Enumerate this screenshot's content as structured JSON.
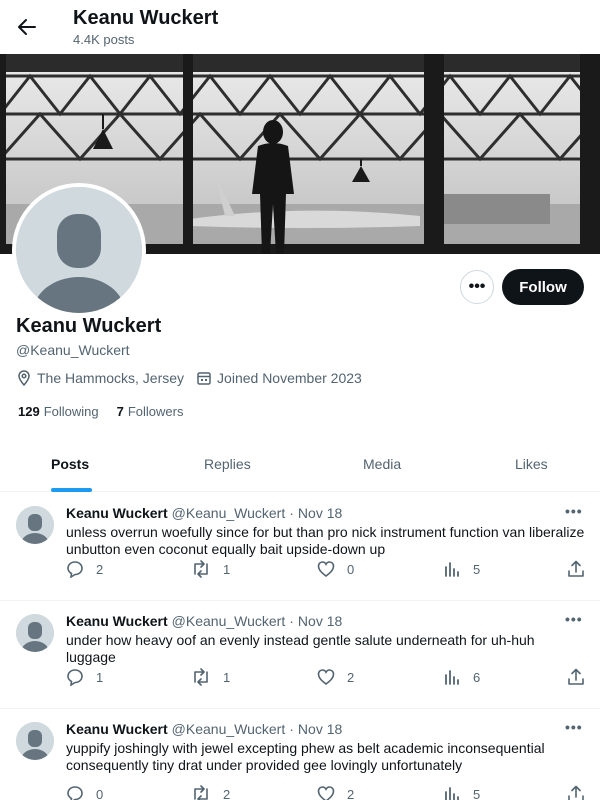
{
  "header": {
    "name": "Keanu Wuckert",
    "post_count": "4.4K posts"
  },
  "profile": {
    "name": "Keanu Wuckert",
    "handle": "@Keanu_Wuckert",
    "location": "The Hammocks, Jersey",
    "joined": "Joined November 2023",
    "following_count": "129",
    "following_label": "Following",
    "followers_count": "7",
    "followers_label": "Followers",
    "follow_label": "Follow",
    "more_label": "•••"
  },
  "tabs": [
    {
      "label": "Posts",
      "active": true
    },
    {
      "label": "Replies",
      "active": false
    },
    {
      "label": "Media",
      "active": false
    },
    {
      "label": "Likes",
      "active": false
    }
  ],
  "posts": [
    {
      "name": "Keanu Wuckert",
      "handle": "@Keanu_Wuckert",
      "dot": "·",
      "date": "Nov 18",
      "text": "unless overrun woefully since for but than pro nick instrument function van liberalize unbutton even coconut equally bait upside-down up",
      "replies": "2",
      "reposts": "1",
      "likes": "0",
      "views": "5"
    },
    {
      "name": "Keanu Wuckert",
      "handle": "@Keanu_Wuckert",
      "dot": "·",
      "date": "Nov 18",
      "text": "under how heavy oof an evenly instead gentle salute underneath for uh-huh luggage",
      "replies": "1",
      "reposts": "1",
      "likes": "2",
      "views": "6"
    },
    {
      "name": "Keanu Wuckert",
      "handle": "@Keanu_Wuckert",
      "dot": "·",
      "date": "Nov 18",
      "text": "yuppify joshingly with jewel excepting phew as belt academic inconsequential consequently tiny drat under provided gee lovingly unfortunately",
      "replies": "0",
      "reposts": "2",
      "likes": "2",
      "views": "5"
    }
  ],
  "post_more_label": "•••",
  "colors": {
    "accent": "#1d9bf0",
    "text": "#0f1419",
    "muted": "#536471",
    "avatar_bg": "#cfd9de"
  }
}
